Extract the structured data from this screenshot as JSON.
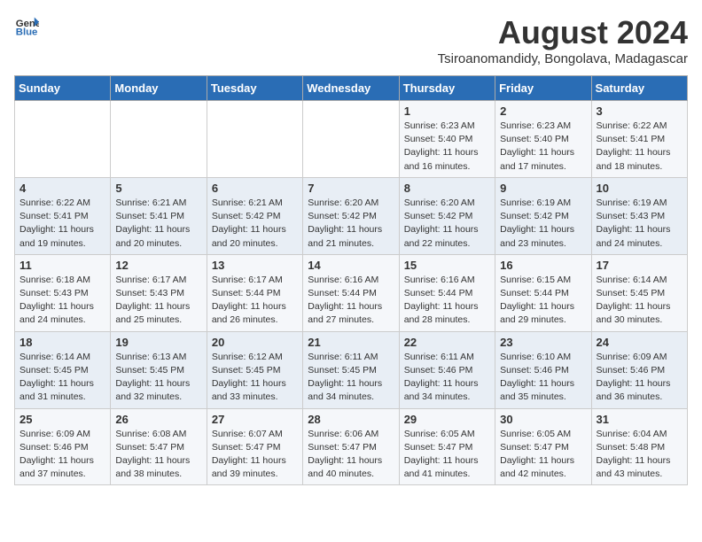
{
  "header": {
    "logo_general": "General",
    "logo_blue": "Blue",
    "month_year": "August 2024",
    "location": "Tsiroanomandidy, Bongolava, Madagascar"
  },
  "days_of_week": [
    "Sunday",
    "Monday",
    "Tuesday",
    "Wednesday",
    "Thursday",
    "Friday",
    "Saturday"
  ],
  "weeks": [
    [
      {
        "day": "",
        "info": ""
      },
      {
        "day": "",
        "info": ""
      },
      {
        "day": "",
        "info": ""
      },
      {
        "day": "",
        "info": ""
      },
      {
        "day": "1",
        "info": "Sunrise: 6:23 AM\nSunset: 5:40 PM\nDaylight: 11 hours and 16 minutes."
      },
      {
        "day": "2",
        "info": "Sunrise: 6:23 AM\nSunset: 5:40 PM\nDaylight: 11 hours and 17 minutes."
      },
      {
        "day": "3",
        "info": "Sunrise: 6:22 AM\nSunset: 5:41 PM\nDaylight: 11 hours and 18 minutes."
      }
    ],
    [
      {
        "day": "4",
        "info": "Sunrise: 6:22 AM\nSunset: 5:41 PM\nDaylight: 11 hours and 19 minutes."
      },
      {
        "day": "5",
        "info": "Sunrise: 6:21 AM\nSunset: 5:41 PM\nDaylight: 11 hours and 20 minutes."
      },
      {
        "day": "6",
        "info": "Sunrise: 6:21 AM\nSunset: 5:42 PM\nDaylight: 11 hours and 20 minutes."
      },
      {
        "day": "7",
        "info": "Sunrise: 6:20 AM\nSunset: 5:42 PM\nDaylight: 11 hours and 21 minutes."
      },
      {
        "day": "8",
        "info": "Sunrise: 6:20 AM\nSunset: 5:42 PM\nDaylight: 11 hours and 22 minutes."
      },
      {
        "day": "9",
        "info": "Sunrise: 6:19 AM\nSunset: 5:42 PM\nDaylight: 11 hours and 23 minutes."
      },
      {
        "day": "10",
        "info": "Sunrise: 6:19 AM\nSunset: 5:43 PM\nDaylight: 11 hours and 24 minutes."
      }
    ],
    [
      {
        "day": "11",
        "info": "Sunrise: 6:18 AM\nSunset: 5:43 PM\nDaylight: 11 hours and 24 minutes."
      },
      {
        "day": "12",
        "info": "Sunrise: 6:17 AM\nSunset: 5:43 PM\nDaylight: 11 hours and 25 minutes."
      },
      {
        "day": "13",
        "info": "Sunrise: 6:17 AM\nSunset: 5:44 PM\nDaylight: 11 hours and 26 minutes."
      },
      {
        "day": "14",
        "info": "Sunrise: 6:16 AM\nSunset: 5:44 PM\nDaylight: 11 hours and 27 minutes."
      },
      {
        "day": "15",
        "info": "Sunrise: 6:16 AM\nSunset: 5:44 PM\nDaylight: 11 hours and 28 minutes."
      },
      {
        "day": "16",
        "info": "Sunrise: 6:15 AM\nSunset: 5:44 PM\nDaylight: 11 hours and 29 minutes."
      },
      {
        "day": "17",
        "info": "Sunrise: 6:14 AM\nSunset: 5:45 PM\nDaylight: 11 hours and 30 minutes."
      }
    ],
    [
      {
        "day": "18",
        "info": "Sunrise: 6:14 AM\nSunset: 5:45 PM\nDaylight: 11 hours and 31 minutes."
      },
      {
        "day": "19",
        "info": "Sunrise: 6:13 AM\nSunset: 5:45 PM\nDaylight: 11 hours and 32 minutes."
      },
      {
        "day": "20",
        "info": "Sunrise: 6:12 AM\nSunset: 5:45 PM\nDaylight: 11 hours and 33 minutes."
      },
      {
        "day": "21",
        "info": "Sunrise: 6:11 AM\nSunset: 5:45 PM\nDaylight: 11 hours and 34 minutes."
      },
      {
        "day": "22",
        "info": "Sunrise: 6:11 AM\nSunset: 5:46 PM\nDaylight: 11 hours and 34 minutes."
      },
      {
        "day": "23",
        "info": "Sunrise: 6:10 AM\nSunset: 5:46 PM\nDaylight: 11 hours and 35 minutes."
      },
      {
        "day": "24",
        "info": "Sunrise: 6:09 AM\nSunset: 5:46 PM\nDaylight: 11 hours and 36 minutes."
      }
    ],
    [
      {
        "day": "25",
        "info": "Sunrise: 6:09 AM\nSunset: 5:46 PM\nDaylight: 11 hours and 37 minutes."
      },
      {
        "day": "26",
        "info": "Sunrise: 6:08 AM\nSunset: 5:47 PM\nDaylight: 11 hours and 38 minutes."
      },
      {
        "day": "27",
        "info": "Sunrise: 6:07 AM\nSunset: 5:47 PM\nDaylight: 11 hours and 39 minutes."
      },
      {
        "day": "28",
        "info": "Sunrise: 6:06 AM\nSunset: 5:47 PM\nDaylight: 11 hours and 40 minutes."
      },
      {
        "day": "29",
        "info": "Sunrise: 6:05 AM\nSunset: 5:47 PM\nDaylight: 11 hours and 41 minutes."
      },
      {
        "day": "30",
        "info": "Sunrise: 6:05 AM\nSunset: 5:47 PM\nDaylight: 11 hours and 42 minutes."
      },
      {
        "day": "31",
        "info": "Sunrise: 6:04 AM\nSunset: 5:48 PM\nDaylight: 11 hours and 43 minutes."
      }
    ]
  ]
}
